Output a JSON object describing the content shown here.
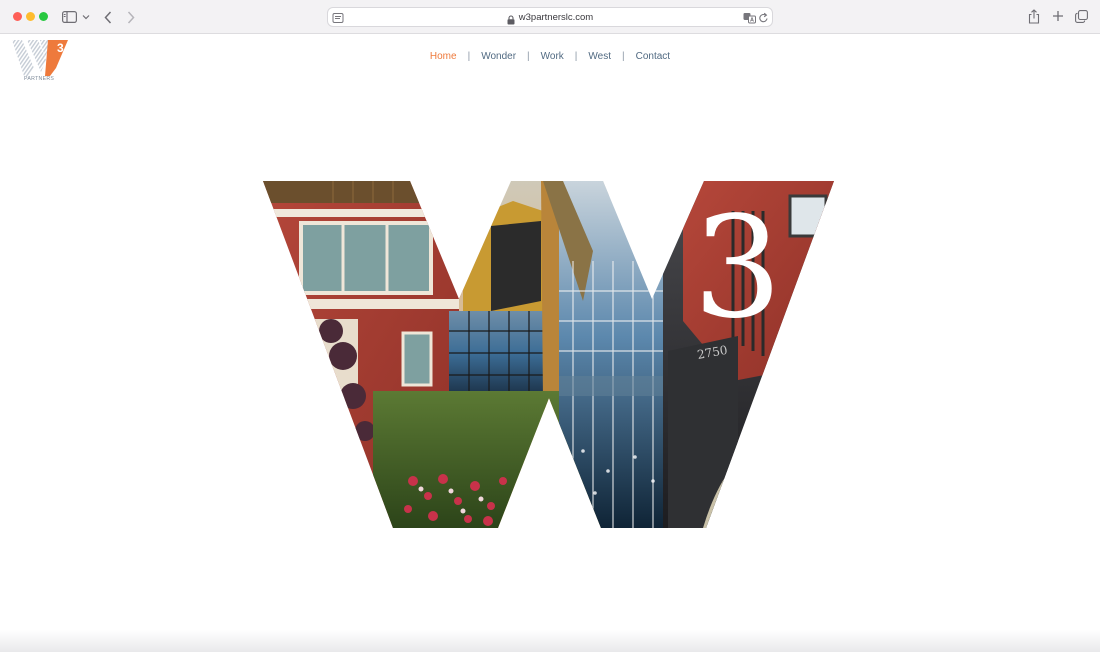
{
  "browser": {
    "url": "w3partnerslc.com"
  },
  "site": {
    "logo": {
      "wordmark": "PARTNERS",
      "superscript": "3",
      "accent_color": "#ee7a3c",
      "icon": "w3-logo"
    },
    "nav": {
      "items": [
        {
          "label": "Home",
          "active": true
        },
        {
          "label": "Wonder",
          "active": false
        },
        {
          "label": "Work",
          "active": false
        },
        {
          "label": "West",
          "active": false
        },
        {
          "label": "Contact",
          "active": false
        }
      ],
      "separator": "|",
      "active_color": "#ee7a3c",
      "text_color": "#516a82"
    },
    "hero": {
      "superscript": "3",
      "building_number": "2750",
      "image_description_icon": "w3-photo-collage"
    }
  }
}
